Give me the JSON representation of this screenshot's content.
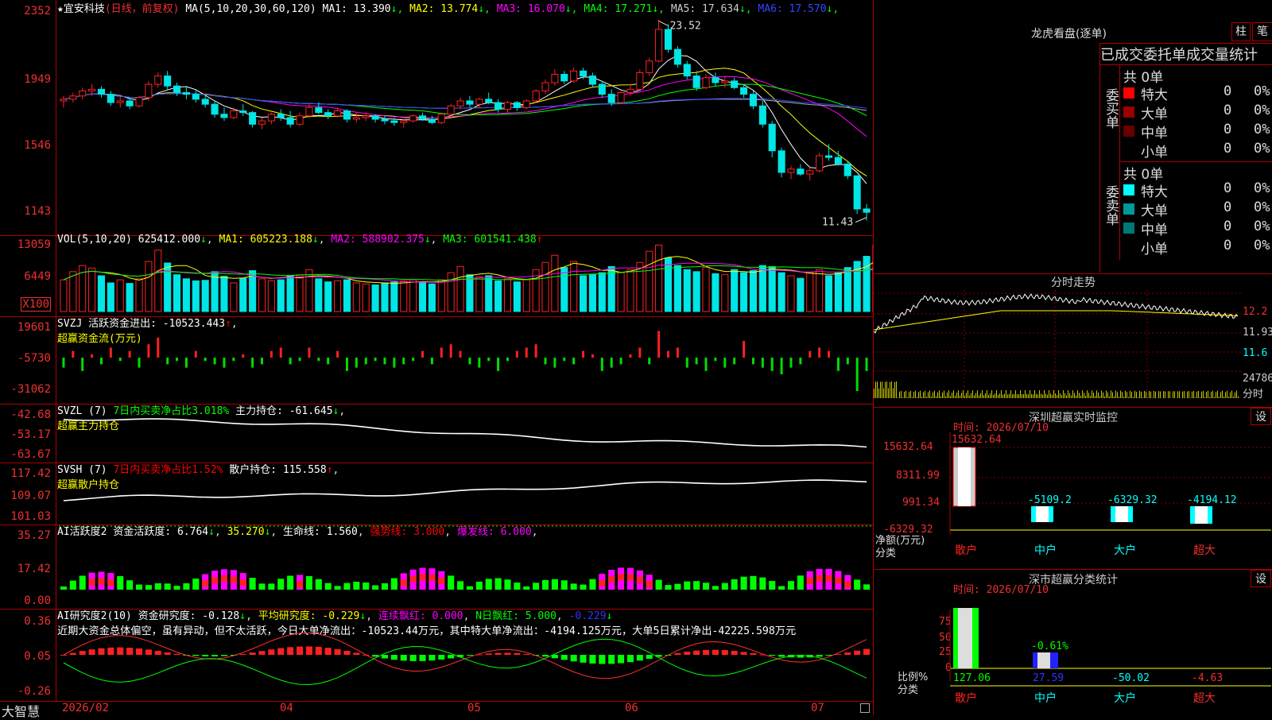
{
  "main": {
    "title_star": "★",
    "stock_name": "宜安科技",
    "period_label": "(日线，前复权)",
    "ma_label": "MA(5,10,20,30,60,120)",
    "ma_values": [
      {
        "label": "MA1: 13.390",
        "color": "#ffffff",
        "arrow": "↓"
      },
      {
        "label": "MA2: 13.774",
        "color": "#ffff00",
        "arrow": "↓"
      },
      {
        "label": "MA3: 16.070",
        "color": "#ff00ff",
        "arrow": "↓"
      },
      {
        "label": "MA4: 17.271",
        "color": "#00ff00",
        "arrow": "↓"
      },
      {
        "label": "MA5: 17.634",
        "color": "#cccccc",
        "arrow": "↓"
      },
      {
        "label": "MA6: 17.570",
        "color": "#3344ff",
        "arrow": "↓"
      }
    ],
    "y_ticks": [
      "2352",
      "1949",
      "1546",
      "1143"
    ],
    "high_label": "23.52",
    "low_label": "11.43",
    "ma_colors": {
      "ma1": "#ffffff",
      "ma2": "#ffff00",
      "ma3": "#ff00ff",
      "ma4": "#00ff00",
      "ma5": "#aaaaaa",
      "ma6": "#3344ff"
    }
  },
  "vol": {
    "name": "VOL(5,10,20)",
    "value": "625412.000",
    "ma1": "MA1: 605223.188",
    "ma2": "MA2: 588902.375",
    "ma3": "MA3: 601541.438",
    "y_ticks": [
      "13059",
      "6449",
      "X100"
    ]
  },
  "svzj": {
    "name": "SVZJ",
    "label": "活跃资金进出: -10523.443",
    "sub": "超赢资金流(万元)",
    "y_ticks": [
      "19601",
      "-5730",
      "-31062"
    ]
  },
  "svzl": {
    "name": "SVZL (7)",
    "label1": "7日内买卖净占比3.018%",
    "label2": "主力持仓: -61.645",
    "sub": "超赢主力持仓",
    "y_ticks": [
      "-42.68",
      "-53.17",
      "-63.67"
    ]
  },
  "svsh": {
    "name": "SVSH (7)",
    "label1": "7日内买卖净占比1.52%",
    "label2": "散户持仓: 115.558",
    "sub": "超赢散户持仓",
    "y_ticks": [
      "117.42",
      "109.07",
      "101.03"
    ]
  },
  "ai1": {
    "name": "AI活跃度2",
    "label": "资金活跃度: 6.764",
    "v2": "35.270",
    "v3": "生命线: 1.560",
    "v4": "强势线: 3.000",
    "v5": "爆发线: 6.000",
    "y_ticks": [
      "35.27",
      "17.42",
      "0.00"
    ]
  },
  "ai2": {
    "name": "AI研究度2(10)",
    "label": "资金研究度: -0.128",
    "v2": "平均研究度: -0.229",
    "v3": "连续飘红: 0.000",
    "v4": "N日飘红: 5.000",
    "v5": "-0.229",
    "comment": "近期大资金总体偏空，虽有异动，但不太活跃，今日大单净流出：-10523.44万元，其中特大单净流出：-4194.125万元，大单5日累计净出-42225.598万元",
    "y_ticks": [
      "0.36",
      "0.05",
      "-0.26"
    ]
  },
  "xaxis": {
    "brand": "大智慧",
    "labels": [
      "2026/02",
      "04",
      "05",
      "06",
      "07"
    ]
  },
  "right": {
    "dragon_title": "龙虎看盘(逐单)",
    "btn_zhu": "柱",
    "btn_bi": "笔",
    "table_header": "已成交委托单成交量统计",
    "buy_side": "委买单",
    "sell_side": "委卖单",
    "buy_total": "共 0单",
    "sell_total": "共 0单",
    "buy_rows": [
      {
        "name": "特大",
        "color": "#ff0000",
        "v": "0",
        "p": "0%"
      },
      {
        "name": "大单",
        "color": "#990000",
        "v": "0",
        "p": "0%"
      },
      {
        "name": "中单",
        "color": "#660000",
        "v": "0",
        "p": "0%"
      },
      {
        "name": "小单",
        "color": "",
        "v": "0",
        "p": "0%"
      }
    ],
    "sell_rows": [
      {
        "name": "特大",
        "color": "#00ffff",
        "v": "0",
        "p": "0%"
      },
      {
        "name": "大单",
        "color": "#009999",
        "v": "0",
        "p": "0%"
      },
      {
        "name": "中单",
        "color": "#007777",
        "v": "0",
        "p": "0%"
      },
      {
        "name": "小单",
        "color": "",
        "v": "0",
        "p": "0%"
      }
    ],
    "intraday_title": "分时走势",
    "intraday_ticks": [
      "12.2",
      "11.93",
      "11.6",
      "24786",
      "分时"
    ],
    "sz_title": "深圳超赢实时监控",
    "sz_btn": "设",
    "sz_time": "时间: 2026/07/10",
    "sz_ticks": [
      "15632.64",
      "8311.99",
      "991.34",
      "-6329.32"
    ],
    "sz_axis_label1": "净额(万元)",
    "sz_axis_label2": "分类",
    "sz_top_label": "15632.64",
    "sz_bar_values": [
      "-5109.2",
      "-6329.32",
      "-4194.12"
    ],
    "sz_categories": [
      "散户",
      "中户",
      "大户",
      "超大"
    ],
    "class_title": "深市超赢分类统计",
    "class_btn": "设",
    "class_time": "时间: 2026/07/10",
    "class_ticks": [
      "75",
      "50",
      "25",
      "0"
    ],
    "class_axis_label1": "比例%",
    "class_axis_label2": "分类",
    "class_mid_label": "-0.61%",
    "class_values": [
      "127.06",
      "27.59",
      "-50.02",
      "-4.63"
    ],
    "class_categories": [
      "散户",
      "中户",
      "大户",
      "超大"
    ]
  },
  "candles": [
    [
      18.6,
      18.9,
      18.2,
      18.7
    ],
    [
      18.7,
      19.1,
      18.5,
      18.9
    ],
    [
      18.9,
      19.4,
      18.7,
      19.2
    ],
    [
      19.2,
      19.6,
      18.9,
      19.3
    ],
    [
      19.3,
      19.5,
      18.8,
      19.0
    ],
    [
      19.0,
      19.2,
      18.3,
      18.5
    ],
    [
      18.5,
      18.9,
      18.2,
      18.6
    ],
    [
      18.6,
      18.8,
      18.1,
      18.3
    ],
    [
      18.3,
      18.9,
      18.2,
      18.8
    ],
    [
      18.8,
      19.8,
      18.6,
      19.6
    ],
    [
      19.6,
      20.3,
      19.4,
      20.1
    ],
    [
      20.1,
      20.4,
      19.3,
      19.5
    ],
    [
      19.5,
      19.7,
      18.9,
      19.1
    ],
    [
      19.1,
      19.5,
      18.7,
      19.0
    ],
    [
      19.0,
      19.3,
      18.5,
      18.7
    ],
    [
      18.7,
      18.9,
      18.2,
      18.4
    ],
    [
      18.4,
      18.6,
      17.6,
      17.8
    ],
    [
      17.8,
      18.2,
      17.4,
      17.6
    ],
    [
      17.6,
      18.2,
      17.5,
      18.0
    ],
    [
      18.0,
      18.4,
      17.7,
      17.9
    ],
    [
      17.9,
      18.0,
      17.0,
      17.2
    ],
    [
      17.2,
      17.6,
      16.9,
      17.4
    ],
    [
      17.4,
      17.9,
      17.2,
      17.8
    ],
    [
      17.8,
      18.1,
      17.4,
      17.6
    ],
    [
      17.6,
      18.0,
      17.0,
      17.2
    ],
    [
      17.2,
      17.9,
      17.1,
      17.7
    ],
    [
      17.7,
      18.4,
      17.6,
      18.2
    ],
    [
      18.2,
      18.5,
      17.8,
      17.9
    ],
    [
      17.9,
      18.1,
      17.5,
      17.7
    ],
    [
      17.7,
      18.2,
      17.6,
      18.0
    ],
    [
      18.0,
      18.1,
      17.3,
      17.5
    ],
    [
      17.5,
      17.9,
      17.3,
      17.6
    ],
    [
      17.6,
      17.9,
      17.4,
      17.7
    ],
    [
      17.7,
      17.8,
      17.3,
      17.5
    ],
    [
      17.5,
      17.7,
      17.2,
      17.4
    ],
    [
      17.4,
      17.6,
      17.1,
      17.3
    ],
    [
      17.3,
      17.5,
      17.0,
      17.4
    ],
    [
      17.4,
      17.8,
      17.3,
      17.7
    ],
    [
      17.7,
      17.9,
      17.4,
      17.5
    ],
    [
      17.5,
      17.7,
      17.2,
      17.3
    ],
    [
      17.3,
      17.9,
      17.2,
      17.8
    ],
    [
      17.8,
      18.4,
      17.7,
      18.3
    ],
    [
      18.3,
      18.8,
      18.1,
      18.6
    ],
    [
      18.6,
      18.9,
      18.2,
      18.4
    ],
    [
      18.4,
      18.8,
      18.2,
      18.7
    ],
    [
      18.7,
      19.1,
      18.4,
      18.5
    ],
    [
      18.5,
      18.7,
      17.9,
      18.1
    ],
    [
      18.1,
      18.6,
      17.9,
      18.5
    ],
    [
      18.5,
      18.6,
      18.0,
      18.2
    ],
    [
      18.2,
      18.7,
      18.1,
      18.6
    ],
    [
      18.6,
      19.3,
      18.5,
      19.2
    ],
    [
      19.2,
      19.9,
      19.0,
      19.7
    ],
    [
      19.7,
      20.5,
      19.5,
      20.2
    ],
    [
      20.2,
      20.4,
      19.6,
      19.8
    ],
    [
      19.8,
      20.6,
      19.7,
      20.4
    ],
    [
      20.4,
      20.6,
      19.9,
      20.1
    ],
    [
      20.1,
      20.3,
      19.4,
      19.6
    ],
    [
      19.6,
      19.8,
      18.8,
      19.0
    ],
    [
      19.0,
      19.3,
      18.3,
      18.5
    ],
    [
      18.5,
      19.2,
      18.4,
      19.1
    ],
    [
      19.1,
      19.6,
      18.9,
      19.3
    ],
    [
      19.3,
      20.5,
      19.2,
      20.3
    ],
    [
      20.3,
      21.2,
      20.1,
      21.0
    ],
    [
      21.0,
      23.5,
      20.9,
      22.9
    ],
    [
      22.9,
      23.2,
      21.5,
      21.7
    ],
    [
      21.7,
      21.9,
      20.6,
      20.8
    ],
    [
      20.8,
      21.0,
      19.9,
      20.1
    ],
    [
      20.1,
      20.4,
      19.2,
      19.4
    ],
    [
      19.4,
      20.2,
      19.3,
      20.0
    ],
    [
      20.0,
      20.3,
      19.5,
      19.7
    ],
    [
      19.7,
      20.1,
      19.4,
      19.8
    ],
    [
      19.8,
      20.0,
      19.3,
      19.4
    ],
    [
      19.4,
      19.6,
      18.8,
      19.0
    ],
    [
      19.0,
      19.2,
      18.1,
      18.3
    ],
    [
      18.3,
      18.6,
      17.0,
      17.2
    ],
    [
      17.2,
      17.4,
      15.2,
      15.6
    ],
    [
      15.6,
      15.8,
      14.0,
      14.3
    ],
    [
      14.3,
      14.7,
      13.9,
      14.5
    ],
    [
      14.5,
      14.8,
      14.1,
      14.2
    ],
    [
      14.2,
      14.6,
      13.8,
      14.4
    ],
    [
      14.4,
      15.5,
      14.3,
      15.3
    ],
    [
      15.3,
      16.0,
      15.0,
      15.2
    ],
    [
      15.2,
      15.6,
      14.7,
      14.8
    ],
    [
      14.8,
      15.0,
      13.9,
      14.1
    ],
    [
      14.1,
      13.3,
      11.8,
      12.1
    ],
    [
      12.1,
      12.4,
      11.4,
      11.9
    ]
  ],
  "volumes": [
    620,
    780,
    900,
    850,
    700,
    560,
    620,
    550,
    640,
    980,
    1200,
    950,
    720,
    640,
    600,
    610,
    780,
    690,
    560,
    650,
    800,
    640,
    600,
    620,
    700,
    720,
    820,
    640,
    580,
    600,
    620,
    560,
    540,
    520,
    560,
    580,
    600,
    620,
    560,
    540,
    620,
    760,
    880,
    720,
    680,
    700,
    600,
    640,
    580,
    620,
    820,
    960,
    1100,
    860,
    980,
    700,
    720,
    760,
    880,
    760,
    820,
    960,
    1180,
    1300,
    1050,
    900,
    820,
    780,
    860,
    740,
    720,
    820,
    760,
    800,
    900,
    880,
    760,
    700,
    650,
    760,
    820,
    700,
    760,
    860,
    980,
    1080,
    1300,
    640,
    625
  ],
  "svzj_vals": [
    -3,
    2,
    -4,
    1,
    -2,
    3,
    -1,
    2,
    -3,
    4,
    6,
    -2,
    -1,
    -3,
    2,
    -1,
    -2,
    -3,
    -1,
    1,
    -3,
    -2,
    2,
    3,
    -2,
    -1,
    3,
    -1,
    -2,
    2,
    -4,
    -3,
    -2,
    -1,
    -2,
    -3,
    -2,
    -1,
    2,
    -2,
    3,
    4,
    2,
    -2,
    -3,
    -1,
    -4,
    -1,
    2,
    3,
    4,
    -2,
    -3,
    -1,
    -2,
    2,
    1,
    -4,
    -3,
    -2,
    1,
    3,
    -2,
    8,
    2,
    3,
    -3,
    -2,
    -4,
    -1,
    -3,
    -2,
    5,
    -2,
    -3,
    -4,
    -5,
    -3,
    -2,
    2,
    3,
    2,
    -4,
    -2,
    -10,
    -4
  ]
}
